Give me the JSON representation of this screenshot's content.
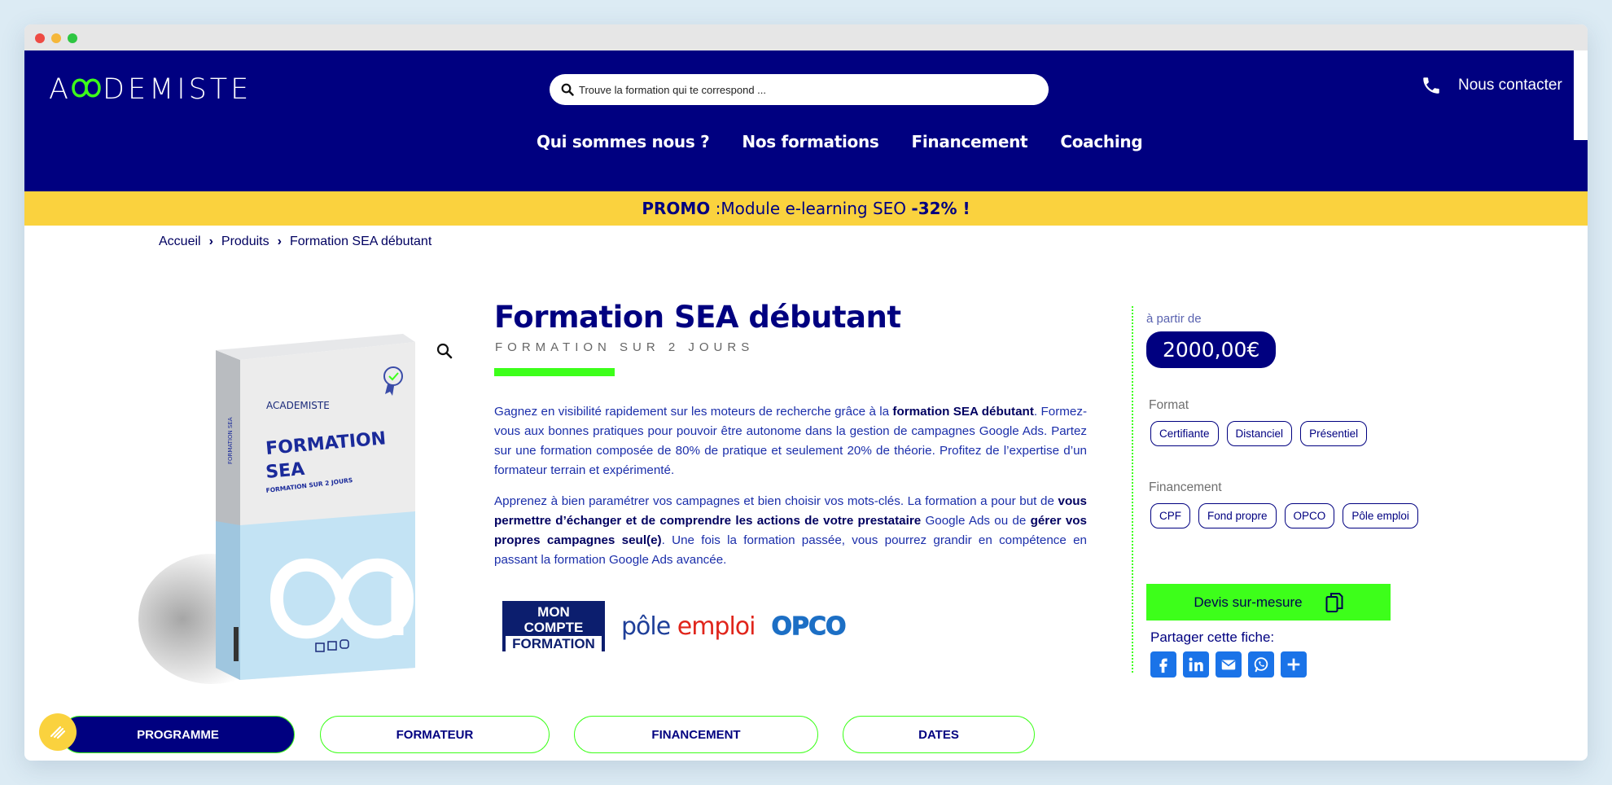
{
  "header": {
    "logo_text": "ACADEMISTE",
    "search_placeholder": "Trouve la formation qui te correspond ...",
    "contact_label": "Nous contacter",
    "nav": [
      "Qui sommes nous ?",
      "Nos formations",
      "Financement",
      "Coaching"
    ]
  },
  "promo": {
    "label": "PROMO",
    "text": " :Module e-learning SEO ",
    "discount": "-32% !"
  },
  "breadcrumb": [
    "Accueil",
    "Produits",
    "Formation SEA débutant"
  ],
  "product_box": {
    "brand": "ACADEMISTE",
    "title_line1": "FORMATION",
    "title_line2": "SEA",
    "subtitle": "FORMATION SUR 2 JOURS",
    "spine": "FORMATION SEA"
  },
  "product": {
    "title": "Formation SEA débutant",
    "subtitle": "FORMATION SUR 2 JOURS",
    "p1_a": "Gagnez en visibilité rapidement sur les moteurs de recherche grâce à la ",
    "p1_b": "formation SEA débutant",
    "p1_c": ". Formez-vous aux bonnes pratiques pour pouvoir être autonome dans la gestion de campagnes Google Ads. Partez sur une formation composée de 80% de pratique et seulement 20% de théorie. Profitez de l’expertise d’un formateur terrain et expérimenté.",
    "p2_a": "Apprenez à bien paramétrer vos campagnes et bien choisir vos mots-clés. La formation a pour but de ",
    "p2_b": "vous permettre d’échanger et de comprendre les actions de votre prestataire",
    "p2_c": " Google Ads ou de ",
    "p2_d": "gérer vos propres campagnes seul(e)",
    "p2_e": ". Une fois la formation passée, vous pourrez grandir en compétence en passant la formation Google Ads avancée.",
    "funders": {
      "mcf": [
        "MON",
        "COMPTE",
        "FORMATION"
      ],
      "pole1": "pôle",
      "pole2": " emploi",
      "opco": "OPCO"
    }
  },
  "sidebar": {
    "from_label": "à partir de",
    "price": "2000,00€",
    "format_label": "Format",
    "format_options": [
      "Certifiante",
      "Distanciel",
      "Présentiel"
    ],
    "financing_label": "Financement",
    "financing_options": [
      "CPF",
      "Fond propre",
      "OPCO",
      "Pôle emploi"
    ],
    "quote_button": "Devis sur-mesure",
    "share_label": "Partager cette fiche:"
  },
  "tabs": [
    "PROGRAMME",
    "FORMATEUR",
    "FINANCEMENT",
    "DATES"
  ],
  "colors": {
    "brand_navy": "#000080",
    "accent_green": "#3dff1a",
    "promo_yellow": "#fad23e"
  }
}
